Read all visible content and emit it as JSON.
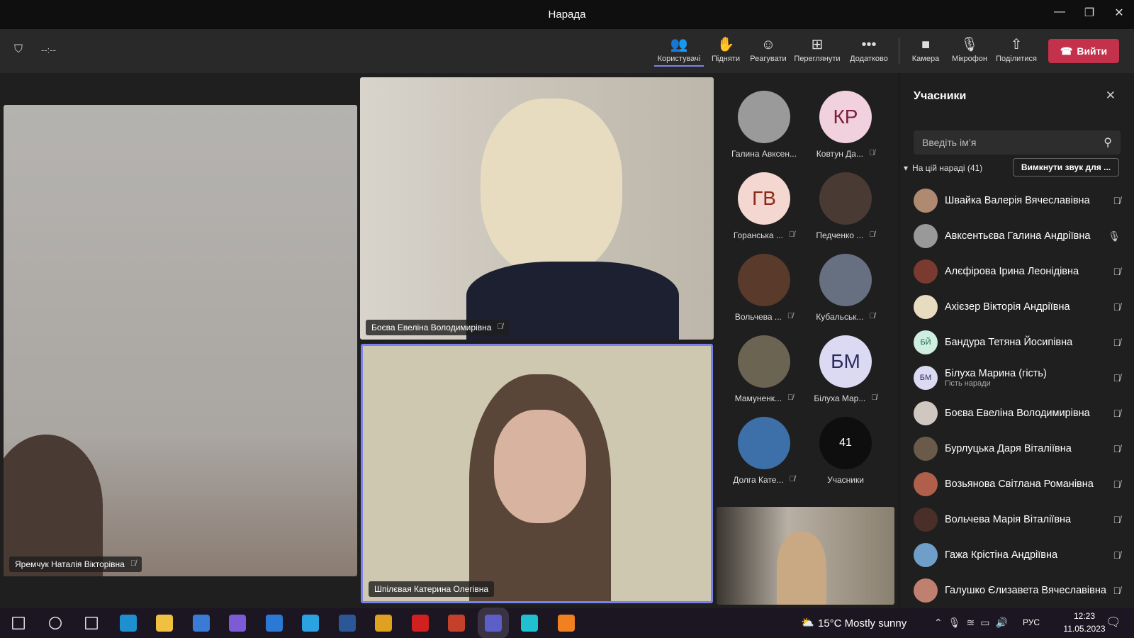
{
  "window": {
    "title": "Нарада",
    "minimize": "—",
    "restore": "❐",
    "close": "✕"
  },
  "toolbar": {
    "timer": "--:--",
    "items": [
      {
        "label": "Користувачі",
        "icon": "people-icon",
        "glyph": "👥"
      },
      {
        "label": "Підняти",
        "icon": "raise-hand-icon",
        "glyph": "✋"
      },
      {
        "label": "Реагувати",
        "icon": "smiley-icon",
        "glyph": "☺"
      },
      {
        "label": "Переглянути",
        "icon": "grid-icon",
        "glyph": "⊞"
      },
      {
        "label": "Додатково",
        "icon": "more-icon",
        "glyph": "•••"
      },
      {
        "label": "Камера",
        "icon": "camera-icon",
        "glyph": "■"
      },
      {
        "label": "Мікрофон",
        "icon": "mic-off-icon",
        "glyph": "🎙"
      },
      {
        "label": "Поділитися",
        "icon": "share-icon",
        "glyph": "⇧"
      }
    ],
    "leave": "Вийти",
    "leave_color": "#c4314b"
  },
  "videos": {
    "left": "Яремчук Наталія Вікторівна",
    "top": "Боєва Евеліна Володимирівна",
    "bottom": "Шпілєвая Катерина Олегівна"
  },
  "grid": [
    {
      "name": "Галина Авксен...",
      "initials": "",
      "muted": false,
      "bg": "#9a9a9a"
    },
    {
      "name": "Ковтун Да...",
      "initials": "КР",
      "muted": true,
      "bg": "#f2d1de",
      "fg": "#7a1f3a"
    },
    {
      "name": "Горанська ...",
      "initials": "ГВ",
      "muted": true,
      "bg": "#f4d7d0",
      "fg": "#8a2a1a"
    },
    {
      "name": "Педченко ...",
      "initials": "",
      "muted": true,
      "bg": "#4a3a34"
    },
    {
      "name": "Вольчева ...",
      "initials": "",
      "muted": true,
      "bg": "#5a3a2a"
    },
    {
      "name": "Кубальськ...",
      "initials": "",
      "muted": true,
      "bg": "#667080"
    },
    {
      "name": "Мамуненк...",
      "initials": "",
      "muted": true,
      "bg": "#6b6452"
    },
    {
      "name": "Білуха Мар...",
      "initials": "БМ",
      "muted": true,
      "bg": "#dcdaf2",
      "fg": "#2b2a5e"
    },
    {
      "name": "Долга Кате...",
      "initials": "",
      "muted": true,
      "bg": "#3d6fa8"
    },
    {
      "name": "Учасники",
      "initials": "41",
      "muted": false,
      "bg": "#0e0e0e",
      "fg": "#fff"
    }
  ],
  "panel": {
    "title": "Учасники",
    "search_placeholder": "Введіть ім’я",
    "section": "На цій нараді (41)",
    "mute_all": "Вимкнути звук для ...",
    "participants": [
      {
        "name": "Швайка Валерія Вячеславівна",
        "initials": "",
        "bg": "#b08a70",
        "mic": "off"
      },
      {
        "name": "Авксентьєва Галина Андріївна",
        "initials": "",
        "bg": "#999",
        "mic": "on"
      },
      {
        "name": "Алєфірова Ірина Леонідівна",
        "initials": "",
        "bg": "#7a3a30",
        "mic": "off"
      },
      {
        "name": "Ахієзер Вікторія Андріївна",
        "initials": "",
        "bg": "#e8dcc0",
        "mic": "off"
      },
      {
        "name": "Бандура Тетяна Йосипівна",
        "initials": "БЙ",
        "bg": "#cdeee0",
        "fg": "#1e6b4a",
        "mic": "off"
      },
      {
        "name": "Білуха Марина (гість)",
        "sub": "Гість наради",
        "initials": "БМ",
        "bg": "#dcdaf2",
        "fg": "#2b2a5e",
        "mic": "off"
      },
      {
        "name": "Боєва Евеліна Володимирівна",
        "initials": "",
        "bg": "#d0c8c0",
        "mic": "off"
      },
      {
        "name": "Бурлуцька Даря Віталіївна",
        "initials": "",
        "bg": "#6a5a4a",
        "mic": "off"
      },
      {
        "name": "Возьянова Світлана Романівна",
        "initials": "",
        "bg": "#b0604a",
        "mic": "off"
      },
      {
        "name": "Вольчева Марія Віталіївна",
        "initials": "",
        "bg": "#4a2e28",
        "mic": "off"
      },
      {
        "name": "Гажа Крістіна Андріївна",
        "initials": "",
        "bg": "#6f9fc8",
        "mic": "off"
      },
      {
        "name": "Галушко Єлизавета Вячеславівна",
        "initials": "",
        "bg": "#c08070",
        "mic": "off"
      }
    ]
  },
  "taskbar": {
    "weather": "15°C  Mostly sunny",
    "lang": "РУС",
    "time": "12:23",
    "date": "11.05.2023",
    "apps": [
      "start",
      "search",
      "task-view",
      "edge",
      "explorer",
      "store",
      "viber",
      "mail",
      "telegram",
      "word",
      "chrome",
      "opera",
      "powerpoint",
      "teams",
      "canva",
      "app"
    ]
  }
}
